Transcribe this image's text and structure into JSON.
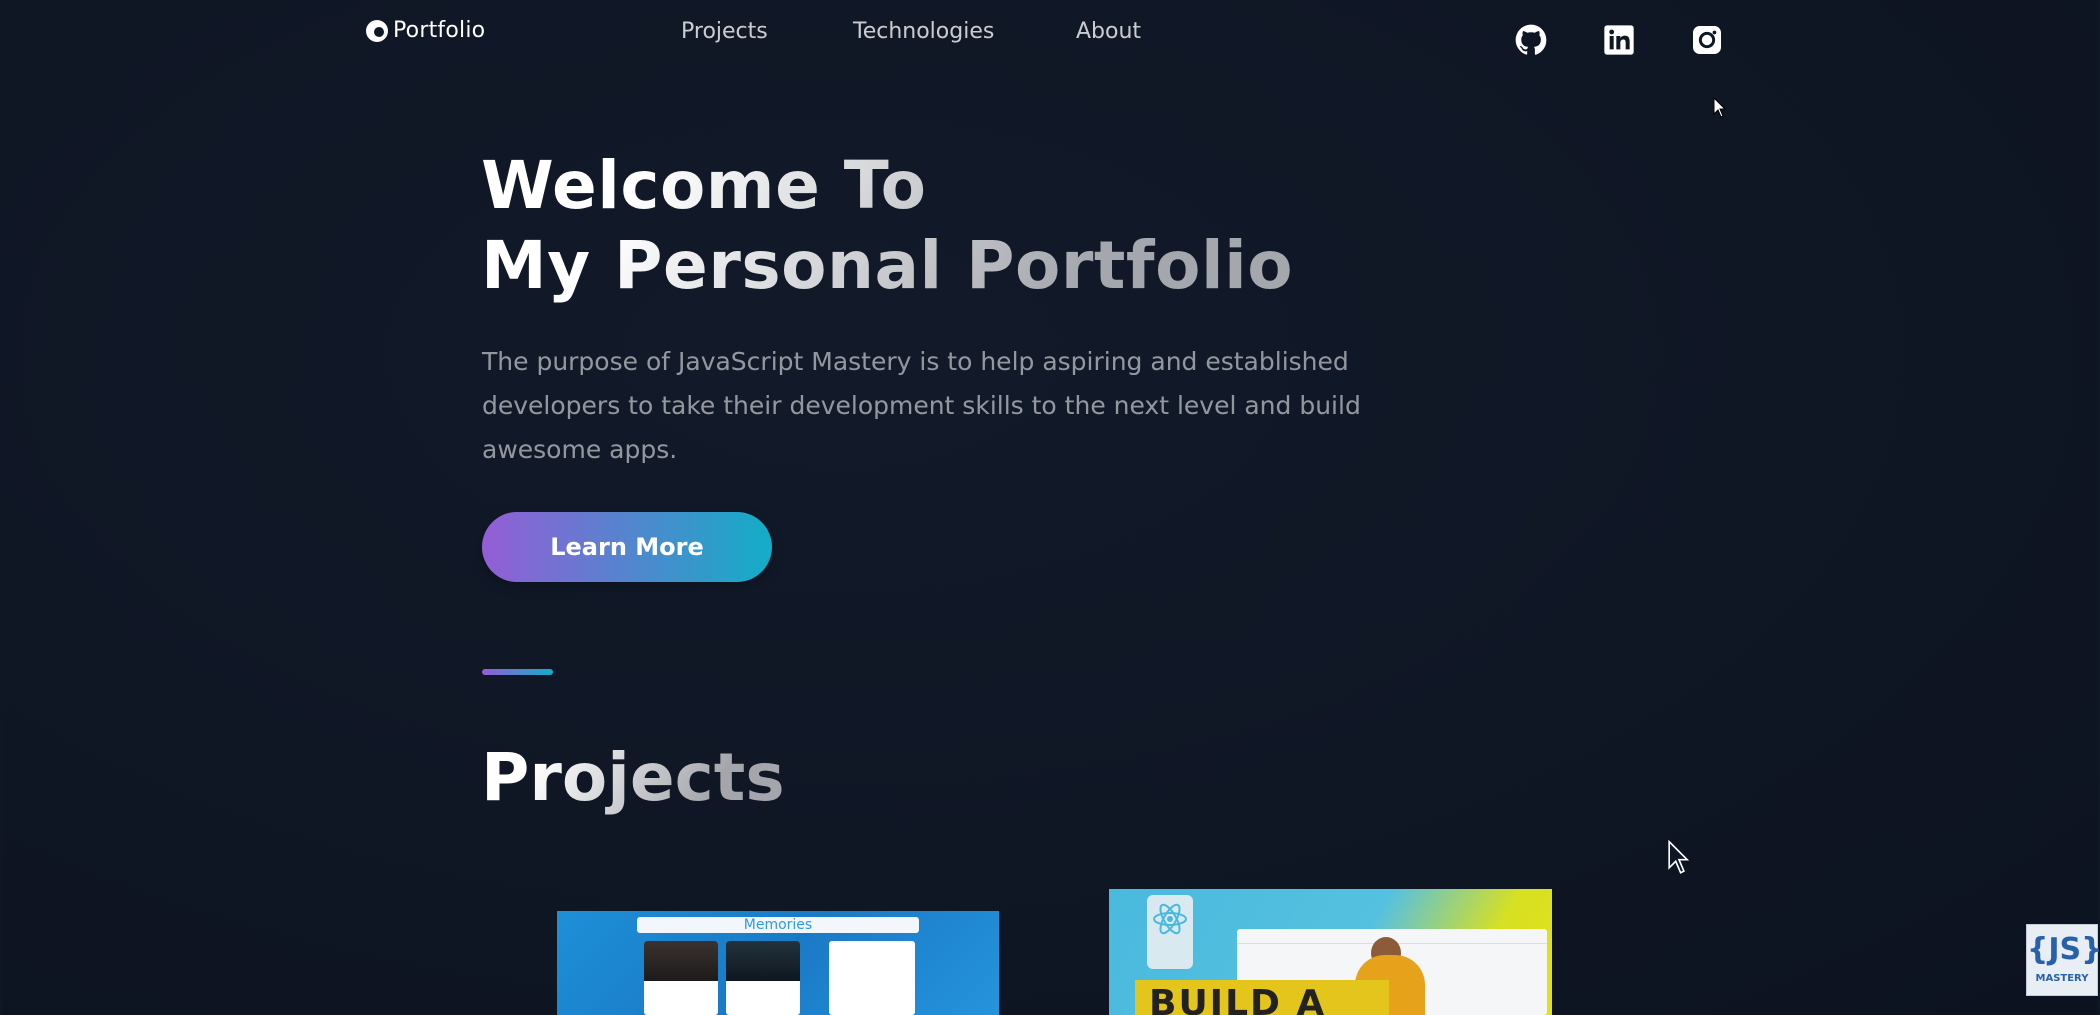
{
  "header": {
    "logo_text": "Portfolio",
    "nav": [
      {
        "label": "Projects"
      },
      {
        "label": "Technologies"
      },
      {
        "label": "About"
      }
    ],
    "social": [
      {
        "icon": "github-icon"
      },
      {
        "icon": "linkedin-icon"
      },
      {
        "icon": "instagram-icon"
      }
    ]
  },
  "hero": {
    "title_line1": "Welcome To",
    "title_line2": "My Personal Portfolio",
    "description": "The purpose of JavaScript Mastery is to help aspiring and established developers to take their development skills to the next level and build awesome apps.",
    "button_label": "Learn More"
  },
  "projects": {
    "title": "Projects",
    "cards": [
      {
        "preview_title": "Memories"
      },
      {
        "preview_title": "BUILD A"
      }
    ]
  },
  "watermark": {
    "top": "{JS}",
    "bottom": "MASTERY"
  },
  "colors": {
    "background": "#0f1624",
    "accent_start": "#945dd6",
    "accent_end": "#13adc7"
  }
}
